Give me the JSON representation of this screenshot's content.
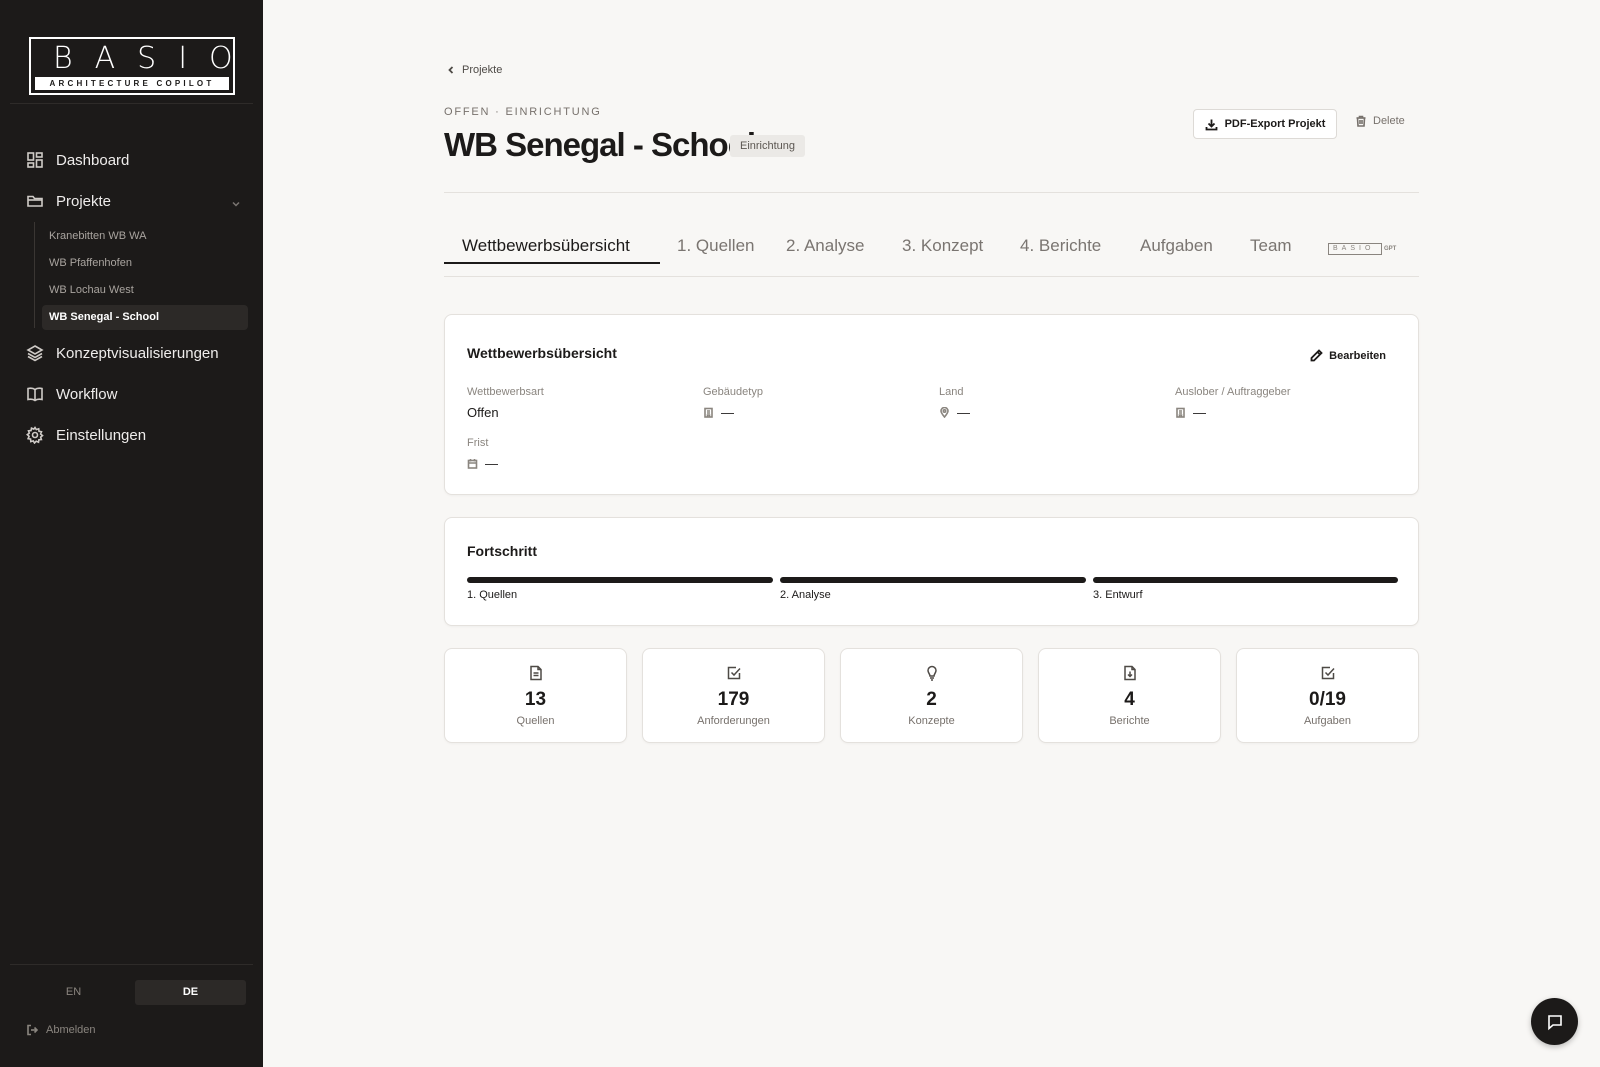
{
  "sidebar": {
    "logo": {
      "word": "BASIO",
      "tagline": "ARCHITECTURE COPILOT"
    },
    "nav": {
      "dashboard": "Dashboard",
      "projects": "Projekte",
      "concepts": "Konzeptvisualisierungen",
      "workflow": "Workflow",
      "settings": "Einstellungen"
    },
    "projects": [
      {
        "label": "Kranebitten WB WA"
      },
      {
        "label": "WB Pfaffenhofen"
      },
      {
        "label": "WB Lochau West"
      },
      {
        "label": "WB Senegal - School",
        "active": true
      }
    ],
    "lang": {
      "en": "EN",
      "de": "DE",
      "selected": "DE"
    },
    "logout": "Abmelden"
  },
  "header": {
    "breadcrumb": "Projekte",
    "overline": "OFFEN · EINRICHTUNG",
    "title": "WB Senegal - School",
    "badge": "Einrichtung",
    "pdf_button": "PDF-Export Projekt",
    "delete_button": "Delete"
  },
  "tabs": [
    {
      "label": "Wettbewerbsübersicht",
      "active": true
    },
    {
      "label": "1. Quellen"
    },
    {
      "label": "2. Analyse"
    },
    {
      "label": "3. Konzept"
    },
    {
      "label": "4. Berichte"
    },
    {
      "label": "Aufgaben"
    },
    {
      "label": "Team"
    }
  ],
  "gpt_tab": {
    "word": "BASIO",
    "suffix": "GPT"
  },
  "overview": {
    "title": "Wettbewerbsübersicht",
    "edit": "Bearbeiten",
    "fields": {
      "type": {
        "label": "Wettbewerbsart",
        "value": "Offen"
      },
      "building": {
        "label": "Gebäudetyp",
        "value": "—"
      },
      "country": {
        "label": "Land",
        "value": "—"
      },
      "client": {
        "label": "Auslober / Auftraggeber",
        "value": "—"
      },
      "deadline": {
        "label": "Frist",
        "value": "—"
      }
    }
  },
  "progress": {
    "title": "Fortschritt",
    "steps": [
      {
        "label": "1. Quellen",
        "value": 1.0
      },
      {
        "label": "2. Analyse",
        "value": 1.0
      },
      {
        "label": "3. Entwurf",
        "value": 1.0
      }
    ]
  },
  "stats": [
    {
      "value": "13",
      "label": "Quellen",
      "icon": "document-icon"
    },
    {
      "value": "179",
      "label": "Anforderungen",
      "icon": "checkbox-icon"
    },
    {
      "value": "2",
      "label": "Konzepte",
      "icon": "lightbulb-icon"
    },
    {
      "value": "4",
      "label": "Berichte",
      "icon": "file-download-icon"
    },
    {
      "value": "0/19",
      "label": "Aufgaben",
      "icon": "checkbox-icon"
    }
  ],
  "colors": {
    "sidebar": "#1c1a19",
    "background": "#f8f7f5",
    "accent": "#1c1a19"
  }
}
